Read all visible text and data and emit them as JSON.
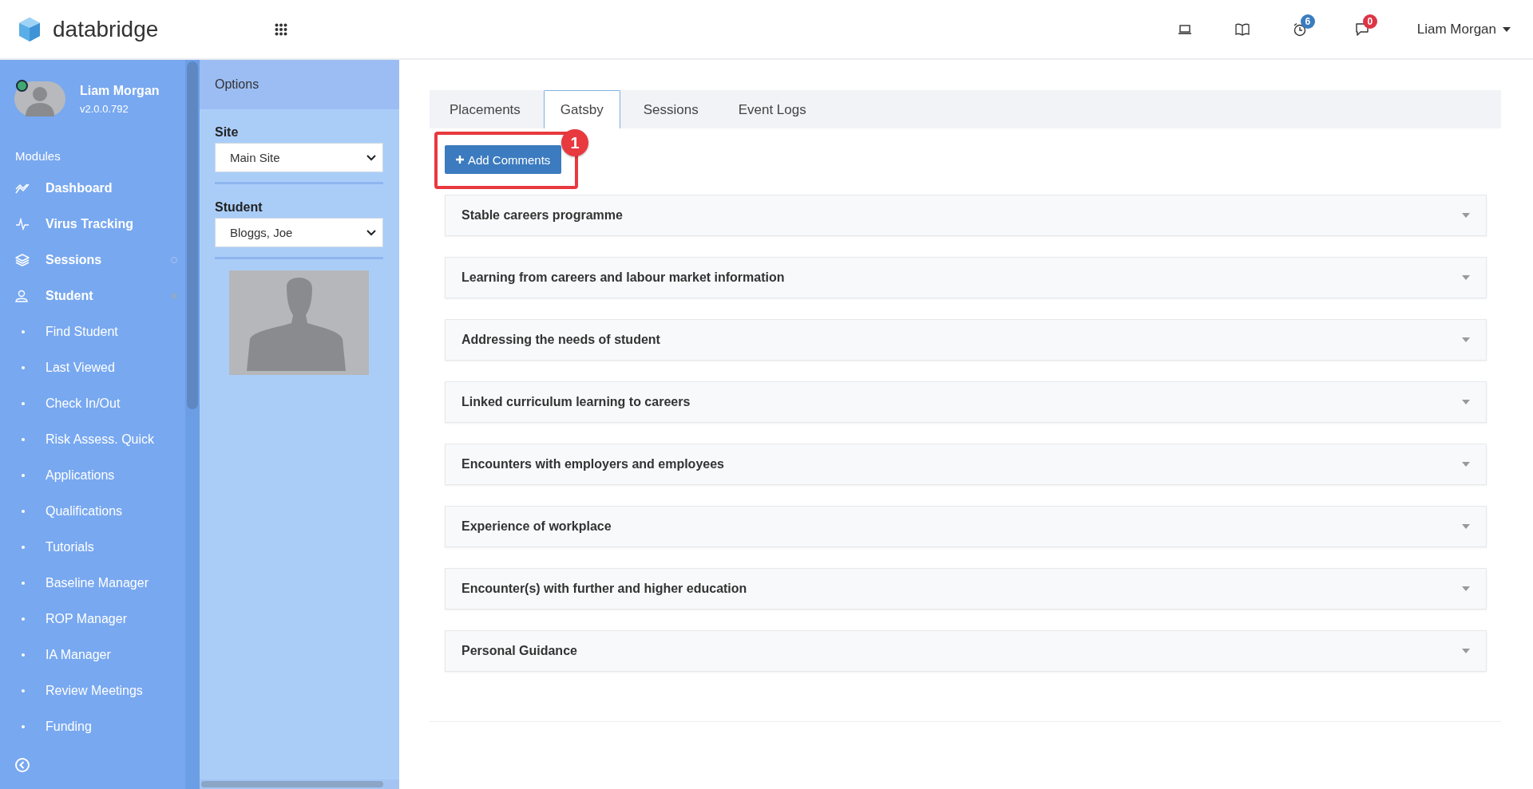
{
  "header": {
    "brand": "databridge",
    "alarm_count": "6",
    "message_count": "0",
    "user": "Liam Morgan"
  },
  "sidebar": {
    "profile": {
      "name": "Liam Morgan",
      "version": "v2.0.0.792",
      "online": true
    },
    "section": "Modules",
    "items": [
      {
        "label": "Dashboard"
      },
      {
        "label": "Virus Tracking"
      },
      {
        "label": "Sessions",
        "expanded": false
      },
      {
        "label": "Student",
        "expanded": true,
        "children": [
          {
            "label": "Find Student"
          },
          {
            "label": "Last Viewed"
          },
          {
            "label": "Check In/Out"
          },
          {
            "label": "Risk Assess. Quick"
          },
          {
            "label": "Applications"
          },
          {
            "label": "Qualifications"
          },
          {
            "label": "Tutorials"
          },
          {
            "label": "Baseline Manager"
          },
          {
            "label": "ROP Manager"
          },
          {
            "label": "IA Manager"
          },
          {
            "label": "Review Meetings"
          },
          {
            "label": "Funding"
          }
        ]
      }
    ]
  },
  "options": {
    "title": "Options",
    "fields": [
      {
        "label": "Site",
        "value": "Main Site"
      },
      {
        "label": "Student",
        "value": "Bloggs, Joe"
      }
    ]
  },
  "tabs": [
    {
      "label": "Placements",
      "selected": false
    },
    {
      "label": "Gatsby",
      "selected": true
    },
    {
      "label": "Sessions",
      "selected": false
    },
    {
      "label": "Event Logs",
      "selected": false
    }
  ],
  "add_button": "Add Comments",
  "callout": "1",
  "sections": [
    {
      "title": "Stable careers programme",
      "expanded": false
    },
    {
      "title": "Learning from careers and labour market information",
      "expanded": false
    },
    {
      "title": "Addressing the needs of student",
      "expanded": false
    },
    {
      "title": "Linked curriculum learning to careers",
      "expanded": false
    },
    {
      "title": "Encounters with employers and employees",
      "expanded": false
    },
    {
      "title": "Experience of workplace",
      "expanded": false
    },
    {
      "title": "Encounter(s) with further and higher education",
      "expanded": false
    },
    {
      "title": "Personal Guidance",
      "expanded": false
    }
  ]
}
